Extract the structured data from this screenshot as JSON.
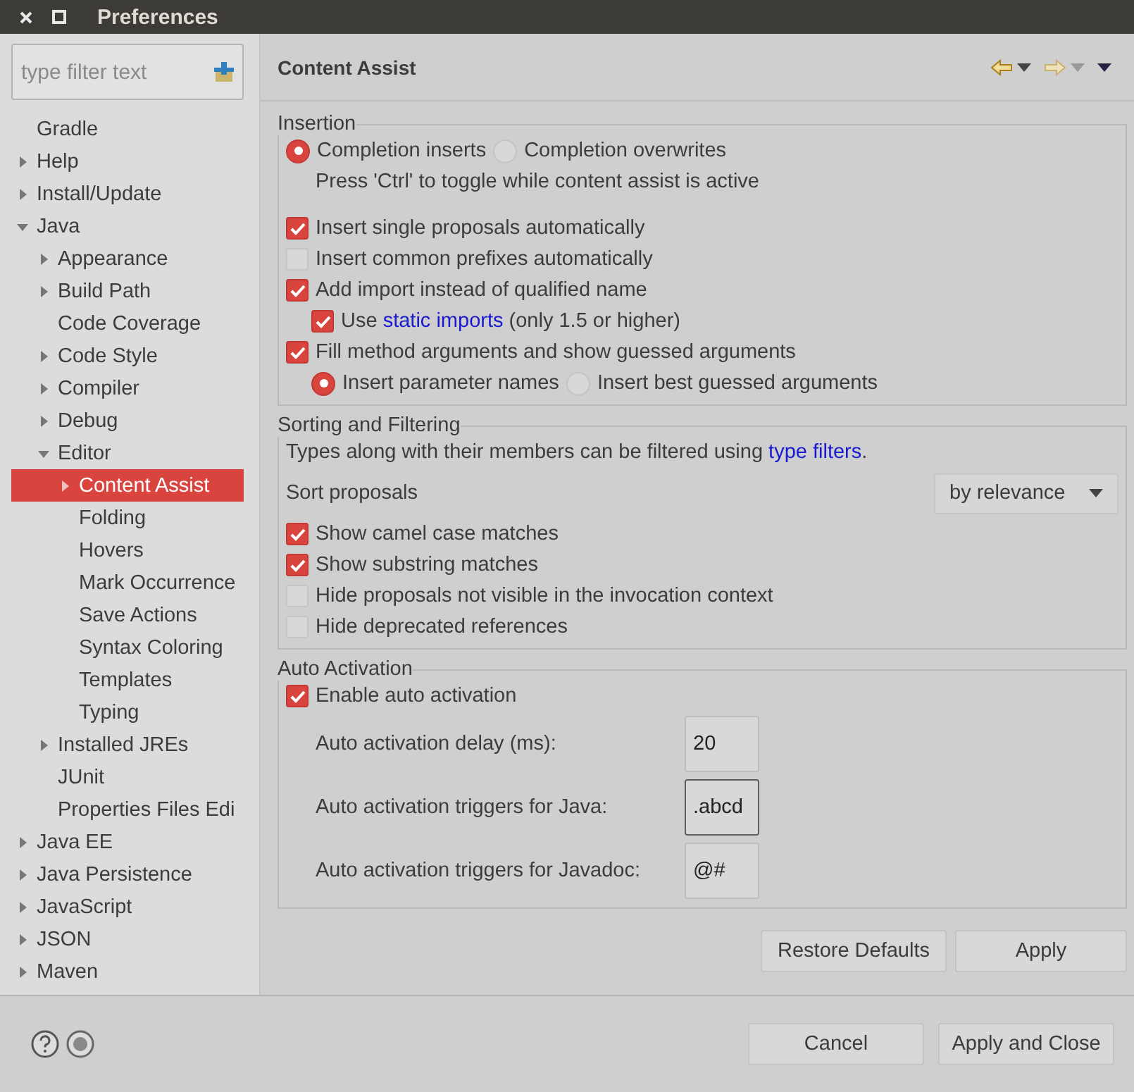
{
  "window": {
    "title": "Preferences"
  },
  "search": {
    "placeholder": "type filter text"
  },
  "tree": [
    {
      "label": "Gradle"
    },
    {
      "label": "Help",
      "expanded": false
    },
    {
      "label": "Install/Update",
      "expanded": false
    },
    {
      "label": "Java",
      "expanded": true,
      "children": [
        {
          "label": "Appearance",
          "expanded": false
        },
        {
          "label": "Build Path",
          "expanded": false
        },
        {
          "label": "Code Coverage"
        },
        {
          "label": "Code Style",
          "expanded": false
        },
        {
          "label": "Compiler",
          "expanded": false
        },
        {
          "label": "Debug",
          "expanded": false
        },
        {
          "label": "Editor",
          "expanded": true,
          "children": [
            {
              "label": "Content Assist",
              "expanded": false,
              "selected": true
            },
            {
              "label": "Folding",
              "selected": false
            },
            {
              "label": "Hovers",
              "selected": false
            },
            {
              "label": "Mark Occurrence",
              "selected": false
            },
            {
              "label": "Save Actions",
              "selected": false
            },
            {
              "label": "Syntax Coloring",
              "selected": false
            },
            {
              "label": "Templates",
              "selected": false
            },
            {
              "label": "Typing",
              "selected": false
            }
          ]
        },
        {
          "label": "Installed JREs",
          "expanded": false
        },
        {
          "label": "JUnit"
        },
        {
          "label": "Properties Files Edi"
        }
      ]
    },
    {
      "label": "Java EE",
      "expanded": false
    },
    {
      "label": "Java Persistence",
      "expanded": false
    },
    {
      "label": "JavaScript",
      "expanded": false
    },
    {
      "label": "JSON",
      "expanded": false
    },
    {
      "label": "Maven",
      "expanded": false
    }
  ],
  "page": {
    "title": "Content Assist"
  },
  "insertion": {
    "title": "Insertion",
    "mode": [
      {
        "label": "Completion inserts",
        "selected": true
      },
      {
        "label": "Completion overwrites",
        "selected": false
      }
    ],
    "note": "Press 'Ctrl' to toggle while content assist is active",
    "options": [
      {
        "kind": "checkbox",
        "label": "Insert single proposals automatically",
        "checked": true
      },
      {
        "kind": "checkbox",
        "label": "Insert common prefixes automatically",
        "checked": false
      },
      {
        "kind": "checkbox",
        "label": "Add import instead of qualified name",
        "checked": true,
        "children": [
          {
            "kind": "link_checkbox",
            "before": "Use",
            "link": "static imports",
            "after": "(only 1.5 or higher)",
            "checked": true
          }
        ]
      },
      {
        "kind": "checkbox",
        "label": "Fill method arguments and show guessed arguments",
        "checked": true,
        "children": [
          {
            "kind": "radio_group",
            "options": [
              {
                "label": "Insert parameter names",
                "selected": true
              },
              {
                "label": "Insert best guessed arguments",
                "selected": false
              }
            ]
          }
        ]
      }
    ]
  },
  "sorting": {
    "title": "Sorting and Filtering",
    "info": {
      "before": "Types along with their members can be filtered using",
      "link": "type filters",
      "after": "."
    },
    "sort_label": "Sort proposals",
    "sort_value": "by relevance",
    "options": [
      {
        "label": "Show camel case matches",
        "checked": true
      },
      {
        "label": "Show substring matches",
        "checked": true
      },
      {
        "label": "Hide proposals not visible in the invocation context",
        "checked": false
      },
      {
        "label": "Hide deprecated references",
        "checked": false
      }
    ]
  },
  "auto_activation": {
    "title": "Auto Activation",
    "enable": {
      "label": "Enable auto activation",
      "checked": true
    },
    "fields": [
      {
        "label": "Auto activation delay (ms):",
        "value": "20",
        "focused": false
      },
      {
        "label": "Auto activation triggers for Java:",
        "value": ".abcd",
        "focused": true
      },
      {
        "label": "Auto activation triggers for Javadoc:",
        "value": "@#",
        "focused": false
      }
    ]
  },
  "page_buttons": [
    "Restore Defaults",
    "Apply"
  ],
  "dialog_buttons": [
    "Cancel",
    "Apply and Close"
  ]
}
